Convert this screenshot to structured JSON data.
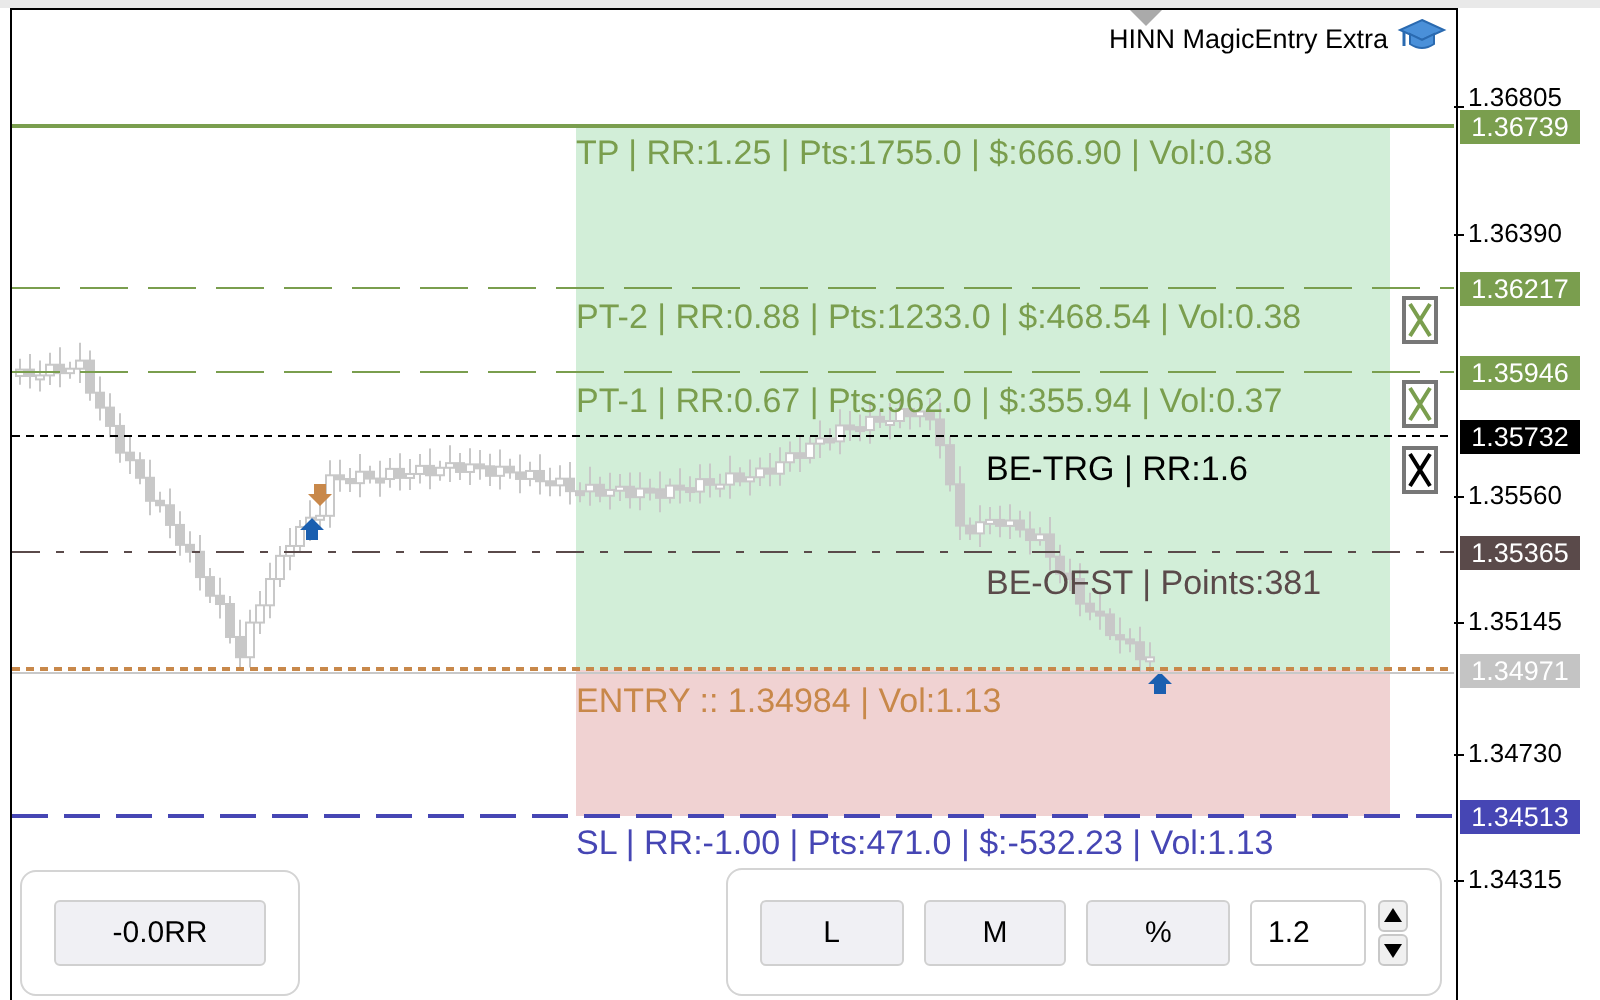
{
  "indicator": {
    "title": "HINN MagicEntry Extra"
  },
  "price_axis": {
    "ticks": [
      "1.36805",
      "1.36390",
      "1.35560",
      "1.35145",
      "1.34730",
      "1.34315"
    ]
  },
  "levels": [
    {
      "kind": "tp",
      "label": "TP | RR:1.25 | Pts:1755.0 | $:666.90 | Vol:0.38",
      "price_tag": "1.36739",
      "color": "#7a9e4e",
      "closable": false
    },
    {
      "kind": "pt2",
      "label": "PT-2 | RR:0.88 | Pts:1233.0 | $:468.54 | Vol:0.38",
      "price_tag": "1.36217",
      "color": "#7a9e4e",
      "closable": true
    },
    {
      "kind": "pt1",
      "label": "PT-1 | RR:0.67 | Pts:962.0 | $:355.94 | Vol:0.37",
      "price_tag": "1.35946",
      "color": "#7a9e4e",
      "closable": true
    },
    {
      "kind": "be_trg",
      "label": "BE-TRG | RR:1.6",
      "price_tag": "1.35732",
      "color": "#000000",
      "closable": true
    },
    {
      "kind": "be_ofst",
      "label": "BE-OFST | Points:381",
      "price_tag": "1.35365",
      "color": "#5a4a4a",
      "closable": false
    },
    {
      "kind": "entry",
      "label": "ENTRY :: 1.34984 | Vol:1.13",
      "price_tag": "1.34971",
      "color": "#c8884a",
      "closable": false
    },
    {
      "kind": "sl",
      "label": "SL | RR:-1.00 | Pts:471.0 | $:-532.23 | Vol:1.13",
      "price_tag": "1.34513",
      "color": "#4646b4",
      "closable": false
    }
  ],
  "left_panel": {
    "buttons": [
      "-0.0RR"
    ]
  },
  "right_panel": {
    "buttons": [
      "L",
      "M",
      "%"
    ],
    "input": {
      "value": "1.2"
    }
  }
}
